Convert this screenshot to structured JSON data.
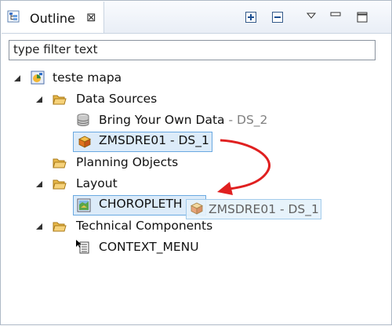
{
  "view": {
    "title": "Outline",
    "close_glyph": "⊠",
    "buttons": [
      "expand-all-icon",
      "collapse-all-icon",
      "view-menu-icon",
      "minimize-icon",
      "maximize-icon"
    ]
  },
  "filter": {
    "placeholder": "type filter text",
    "value": "type filter text"
  },
  "tree": {
    "root": {
      "label": "teste mapa",
      "icon": "application-icon"
    },
    "data_sources": {
      "label": "Data Sources",
      "byod": {
        "label": "Bring Your Own Data",
        "separator": " - ",
        "suffix": "DS_2"
      },
      "zmsdre": {
        "label": "ZMSDRE01 - DS_1"
      }
    },
    "planning": {
      "label": "Planning Objects"
    },
    "layout": {
      "label": "Layout",
      "choropleth": {
        "label": "CHOROPLETH"
      }
    },
    "technical": {
      "label": "Technical Components",
      "context_menu": {
        "label": "CONTEXT_MENU"
      }
    }
  },
  "drag": {
    "label": "ZMSDRE01 - DS_1"
  },
  "colors": {
    "selection_border": "#6aa9e1",
    "selection_fill": "#dcebf9",
    "arrow": "#e02020",
    "folder": "#f0c560"
  }
}
